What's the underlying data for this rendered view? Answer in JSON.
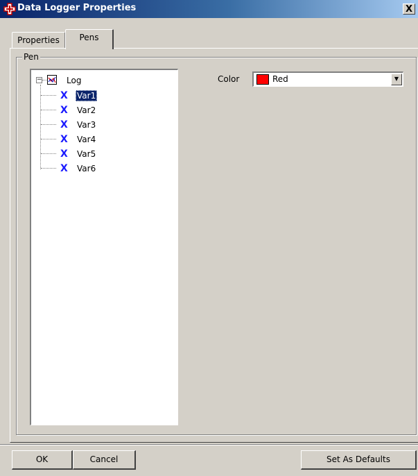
{
  "window": {
    "title": "Data Logger Properties",
    "close_label": "X"
  },
  "tabs": [
    {
      "label": "Properties"
    },
    {
      "label": "Pens",
      "active": true
    }
  ],
  "pen_group": {
    "legend": "Pen",
    "tree": {
      "root": {
        "label": "Log",
        "expander": "⊟",
        "icon": "chart-icon"
      },
      "children": [
        {
          "label": "Var1",
          "icon": "variable-x-icon",
          "selected": true
        },
        {
          "label": "Var2",
          "icon": "variable-x-icon"
        },
        {
          "label": "Var3",
          "icon": "variable-x-icon"
        },
        {
          "label": "Var4",
          "icon": "variable-x-icon"
        },
        {
          "label": "Var5",
          "icon": "variable-x-icon"
        },
        {
          "label": "Var6",
          "icon": "variable-x-icon"
        }
      ]
    },
    "color": {
      "label": "Color",
      "value": "Red",
      "swatch": "#ff0000"
    }
  },
  "buttons": {
    "ok": "OK",
    "cancel": "Cancel",
    "set_defaults": "Set As Defaults"
  },
  "colors": {
    "title_gradient_start": "#0a246a",
    "title_gradient_end": "#a6caf0",
    "dialog_face": "#d4d0c8",
    "selection": "#0a246a",
    "tree_icon": "#1a1aff"
  }
}
